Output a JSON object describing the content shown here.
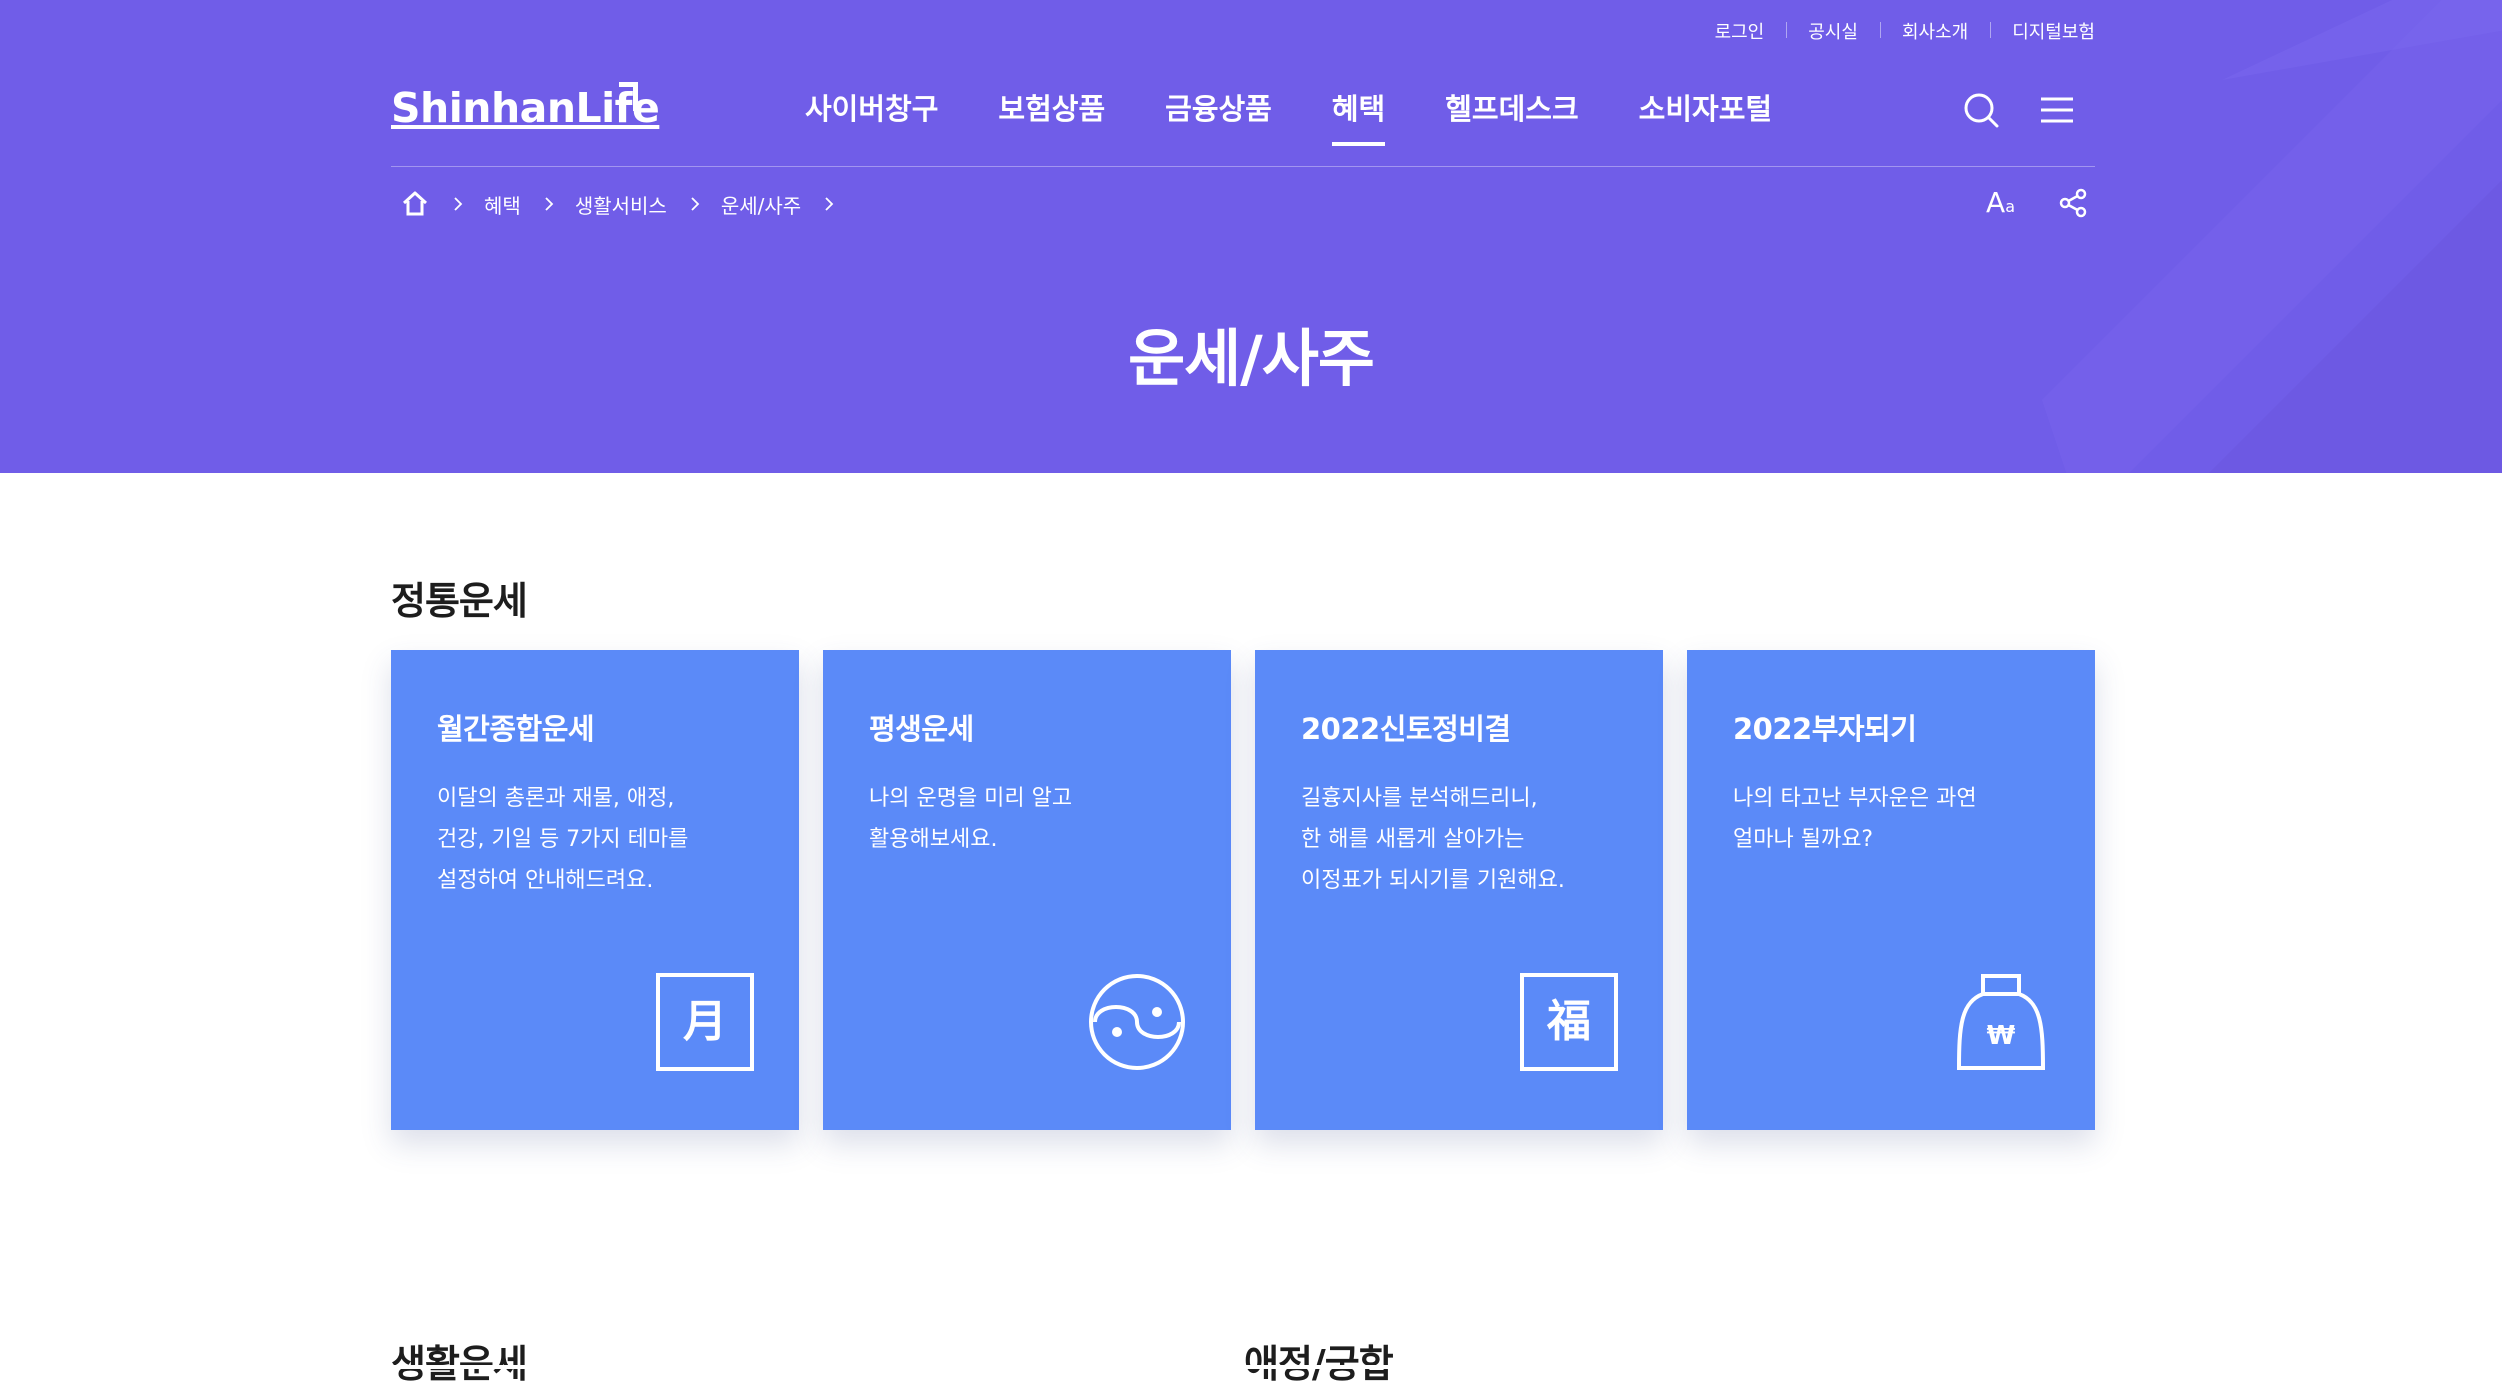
{
  "colors": {
    "hero_bg": "#705de8",
    "card_bg": "#5b8af8",
    "text_dark": "#1d1d1d"
  },
  "utility": [
    "로그인",
    "공시실",
    "회사소개",
    "디지털보험"
  ],
  "logo": {
    "text": "ShinhanLife"
  },
  "menu": [
    {
      "label": "사이버창구",
      "active": false
    },
    {
      "label": "보험상품",
      "active": false
    },
    {
      "label": "금융상품",
      "active": false
    },
    {
      "label": "혜택",
      "active": true
    },
    {
      "label": "헬프데스크",
      "active": false
    },
    {
      "label": "소비자포털",
      "active": false
    }
  ],
  "gnb_icons": {
    "search": "search-icon",
    "menu": "hamburger-menu-icon"
  },
  "breadcrumb": {
    "home_icon": "home-icon",
    "items": [
      "혜택",
      "생활서비스",
      "운세/사주"
    ]
  },
  "tools": {
    "font_size_label": "A",
    "font_size_small": "a",
    "share_icon": "share-icon"
  },
  "page_title": "운세/사주",
  "sections": [
    {
      "title": "정통운세",
      "cards": [
        {
          "title": "월간종합운세",
          "desc": [
            "이달의 총론과 재물, 애정,",
            "건강, 기일 등 7가지 테마를",
            "설정하여 안내해드려요."
          ],
          "icon": "calendar-month-icon",
          "icon_char": "月"
        },
        {
          "title": "평생운세",
          "desc": [
            "나의 운명을 미리 알고",
            "활용해보세요."
          ],
          "icon": "yin-yang-icon",
          "icon_char": ""
        },
        {
          "title": "2022신토정비결",
          "desc": [
            "길흉지사를 분석해드리니,",
            "한 해를 새롭게 살아가는",
            "이정표가 되시기를 기원해요."
          ],
          "icon": "fortune-bok-icon",
          "icon_char": "福"
        },
        {
          "title": "2022부자되기",
          "desc": [
            "나의 타고난 부자운은 과연",
            "얼마나 될까요?"
          ],
          "icon": "money-bag-icon",
          "icon_char": "₩"
        }
      ]
    },
    {
      "title": "생활운세"
    },
    {
      "title": "애정/궁합"
    }
  ]
}
